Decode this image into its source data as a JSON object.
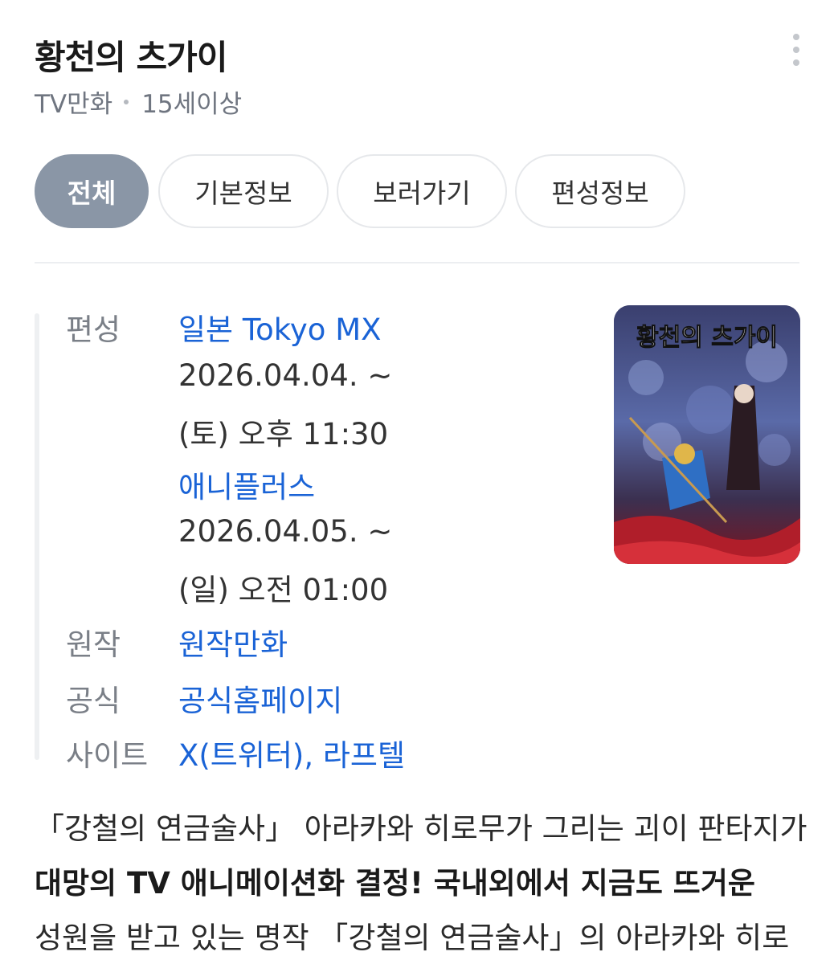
{
  "header": {
    "title": "황천의 츠가이",
    "category": "TV만화",
    "rating": "15세이상"
  },
  "tabs": [
    {
      "label": "전체",
      "active": true
    },
    {
      "label": "기본정보",
      "active": false
    },
    {
      "label": "보러가기",
      "active": false
    },
    {
      "label": "편성정보",
      "active": false
    }
  ],
  "info": {
    "broadcast_label": "편성",
    "broadcasts": [
      {
        "channel": "일본 Tokyo MX",
        "date": "2026.04.04. ~",
        "time": "(토) 오후 11:30"
      },
      {
        "channel": "애니플러스",
        "date": "2026.04.05. ~",
        "time": "(일) 오전 01:00"
      }
    ],
    "original_label": "원작",
    "original_link": "원작만화",
    "official_label_1": "공식",
    "official_label_2": "사이트",
    "official_homepage": "공식홈페이지",
    "twitter": "X(트위터)",
    "separator": ", ",
    "laftel": "라프텔"
  },
  "poster": {
    "title_art": "황천의 츠가이"
  },
  "description": {
    "line1": "「강철의 연금술사」 아라카와 히로무가 그리는 괴이 판타지가",
    "line2_bold": "대망의 TV 애니메이션화 결정! 국내외에서 지금도 뜨거운",
    "line3": "성원을 받고 있는 명작 「강철의 연금술사」의 아라카와 히로"
  },
  "colors": {
    "link": "#1a63d6",
    "active_tab": "#8a96a6",
    "label": "#7a7f87"
  }
}
